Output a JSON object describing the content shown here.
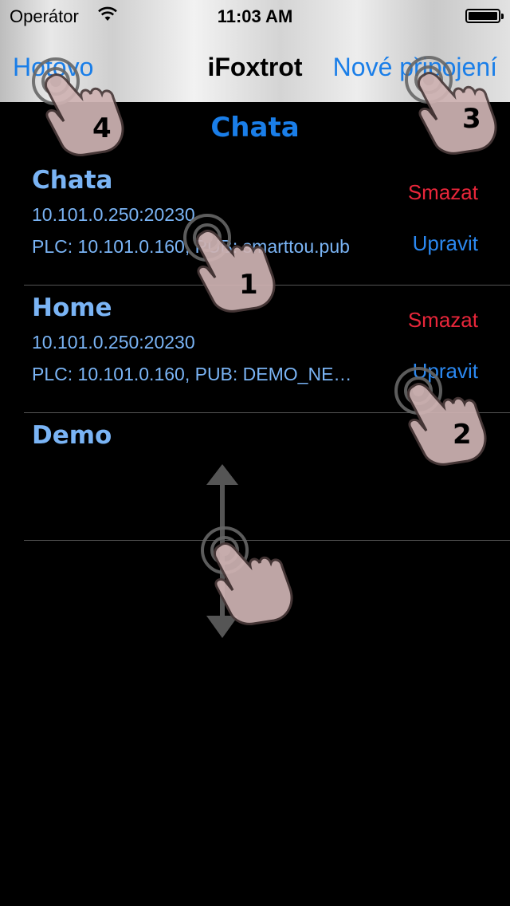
{
  "status_bar": {
    "carrier": "Operátor",
    "wifi_icon": "wifi-icon",
    "time": "11:03 AM",
    "battery_level": 1.0
  },
  "nav": {
    "done_label": "Hotovo",
    "title": "iFoxtrot",
    "new_connection_label": "Nové připojení"
  },
  "section_title": "Chata",
  "connections": [
    {
      "name": "Chata",
      "address": "10.101.0.250:20230",
      "plc": "PLC: 10.101.0.160, PUB: smarttou.pub",
      "delete_label": "Smazat",
      "edit_label": "Upravit"
    },
    {
      "name": "Home",
      "address": "10.101.0.250:20230",
      "plc": "PLC: 10.101.0.160, PUB: DEMO_NE…",
      "delete_label": "Smazat",
      "edit_label": "Upravit"
    },
    {
      "name": "Demo"
    }
  ],
  "tutorial": {
    "icon": "tap-hand-icon",
    "scroll_icon": "vertical-scroll-arrow-icon",
    "step_labels": [
      "1",
      "2",
      "3",
      "4"
    ]
  },
  "colors": {
    "link_blue": "#1a7ee8",
    "row_text_blue": "#7ab4f5",
    "delete_red": "#e8263a",
    "background": "#000000"
  }
}
